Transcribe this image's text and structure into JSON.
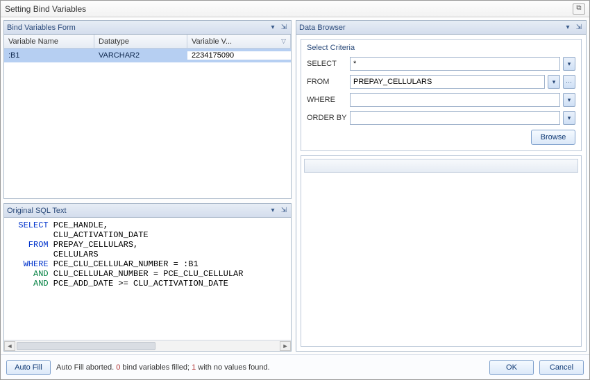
{
  "dialog_title": "Setting Bind Variables",
  "close_glyph": "⧉",
  "panels": {
    "bind_form_title": "Bind Variables Form",
    "sql_title": "Original SQL Text",
    "data_browser_title": "Data Browser",
    "dropdown_glyph": "▾",
    "pin_glyph": "⇲"
  },
  "grid": {
    "headers": {
      "name": "Variable Name",
      "datatype": "Datatype",
      "value": "Variable V..."
    },
    "sort_glyph": "▽",
    "rows": [
      {
        "name": ":B1",
        "datatype": "VARCHAR2",
        "value": "2234175090"
      }
    ]
  },
  "sql": {
    "l1a": "  SELECT",
    "l1b": " PCE_HANDLE,",
    "l2": "         CLU_ACTIVATION_DATE",
    "l3a": "    FROM",
    "l3b": " PREPAY_CELLULARS,",
    "l4": "         CELLULARS",
    "l5a": "   WHERE",
    "l5b": " PCE_CLU_CELLULAR_NUMBER = :B1",
    "l6a": "     AND",
    "l6b": " CLU_CELLULAR_NUMBER = PCE_CLU_CELLULAR",
    "l7a": "     AND",
    "l7b": " PCE_ADD_DATE >= CLU_ACTIVATION_DATE"
  },
  "criteria": {
    "title": "Select Criteria",
    "select_label": "SELECT",
    "select_value": "*",
    "from_label": "FROM",
    "from_value": "PREPAY_CELLULARS",
    "where_label": "WHERE",
    "where_value": "",
    "orderby_label": "ORDER BY",
    "orderby_value": "",
    "dd_glyph": "▾",
    "ell_glyph": "⋯",
    "browse_label": "Browse"
  },
  "footer": {
    "autofill_label": "Auto Fill",
    "status_prefix": "Auto Fill aborted. ",
    "status_num1": "0",
    "status_mid": " bind variables filled; ",
    "status_num2": "1",
    "status_suffix": " with no values found.",
    "ok_label": "OK",
    "cancel_label": "Cancel"
  },
  "scroll": {
    "left": "◄",
    "right": "►"
  }
}
